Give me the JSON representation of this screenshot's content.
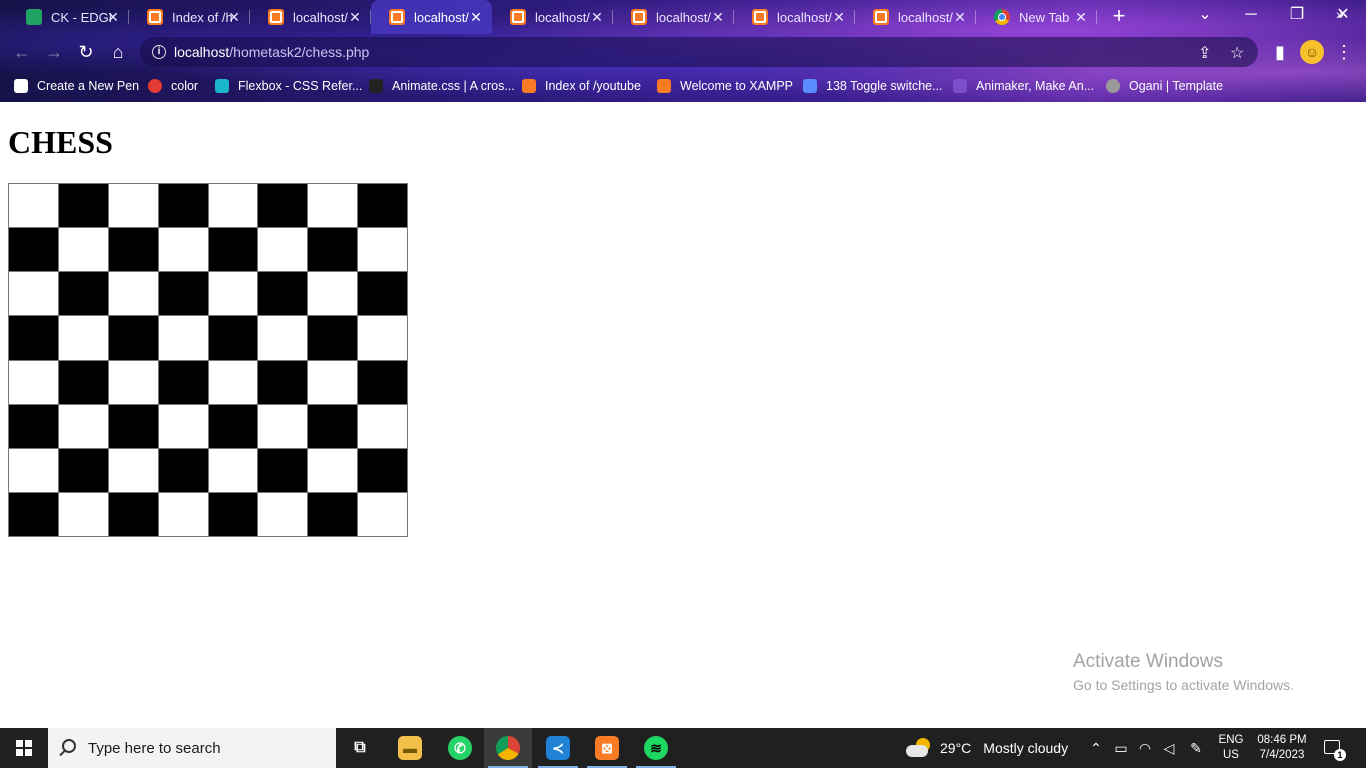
{
  "tabs": [
    {
      "label": "CK - EDGE",
      "icon": "green-tab-icon"
    },
    {
      "label": "Index of /h",
      "icon": "xampp-icon"
    },
    {
      "label": "localhost/",
      "icon": "xampp-icon"
    },
    {
      "label": "localhost/",
      "icon": "xampp-icon",
      "active": true
    },
    {
      "label": "localhost/",
      "icon": "xampp-icon"
    },
    {
      "label": "localhost/",
      "icon": "xampp-icon"
    },
    {
      "label": "localhost/",
      "icon": "xampp-icon"
    },
    {
      "label": "localhost/",
      "icon": "xampp-icon"
    },
    {
      "label": "New Tab",
      "icon": "chrome-icon"
    }
  ],
  "address": {
    "host": "localhost",
    "path": "/hometask2/chess.php"
  },
  "bookmarks": [
    {
      "label": "Create a New Pen",
      "icon": "codepen-icon",
      "color": "#ffffff"
    },
    {
      "label": "color",
      "icon": "color-icon",
      "color": "#e53935"
    },
    {
      "label": "Flexbox - CSS Refer...",
      "icon": "flexbox-icon",
      "color": "#19b5c9"
    },
    {
      "label": "Animate.css | A cros...",
      "icon": "animate-icon",
      "color": "#222222"
    },
    {
      "label": "Index of /youtube",
      "icon": "xampp-icon",
      "color": "#fb7a24"
    },
    {
      "label": "Welcome to XAMPP",
      "icon": "xampp-icon",
      "color": "#fb7a24"
    },
    {
      "label": "138 Toggle switche...",
      "icon": "uiverse-icon",
      "color": "#5b8cff"
    },
    {
      "label": "Animaker, Make An...",
      "icon": "animaker-icon",
      "color": "#7b4fc9"
    },
    {
      "label": "Ogani | Template",
      "icon": "globe-icon",
      "color": "#9a9a9a"
    }
  ],
  "page": {
    "title": "CHESS",
    "board": {
      "rows": 8,
      "cols": 8,
      "first_square": "white",
      "light_color": "#ffffff",
      "dark_color": "#000000"
    }
  },
  "watermark": {
    "line1": "Activate Windows",
    "line2": "Go to Settings to activate Windows."
  },
  "taskbar": {
    "search_placeholder": "Type here to search",
    "weather_temp": "29°C",
    "weather_text": "Mostly cloudy",
    "lang_line1": "ENG",
    "lang_line2": "US",
    "time": "08:46 PM",
    "date": "7/4/2023",
    "notification_count": "1"
  },
  "colors": {
    "accent_tab": "#4a3bbf",
    "taskbar_bg": "#202020"
  }
}
